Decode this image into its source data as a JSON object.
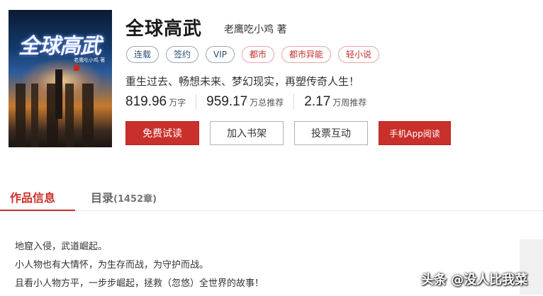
{
  "cover": {
    "title": "全球高武",
    "author": "老鹰吃小鸡 著"
  },
  "book": {
    "title": "全球高武",
    "author_line": "老鹰吃小鸡 著",
    "tags": [
      {
        "label": "连载",
        "style": "blue"
      },
      {
        "label": "签约",
        "style": "blue"
      },
      {
        "label": "VIP",
        "style": "blue"
      },
      {
        "label": "都市",
        "style": "red"
      },
      {
        "label": "都市异能",
        "style": "red"
      },
      {
        "label": "轻小说",
        "style": "red"
      }
    ],
    "intro": "重生过去、畅想未来、梦幻现实，再塑传奇人生！",
    "stats": [
      {
        "num": "819.96",
        "unit": "万字"
      },
      {
        "num": "959.17",
        "unit": "万总推荐"
      },
      {
        "num": "2.17",
        "unit": "万周推荐"
      }
    ]
  },
  "buttons": {
    "free_read": "免费试读",
    "add_shelf": "加入书架",
    "vote": "投票互动",
    "app_read": "手机App阅读"
  },
  "tabs": {
    "info": "作品信息",
    "catalog": "目录",
    "catalog_count": "(1452章)"
  },
  "description": [
    "地窟入侵，武道崛起。",
    "小人物也有大情怀，为生存而战，为守护而战。",
    "且看小人物方平，一步步崛起，拯救（忽悠）全世界的故事！"
  ],
  "watermark": "头条 @没人比我菜",
  "colors": {
    "accent": "#c9302b",
    "tag_blue": "#2d4f73",
    "tag_red": "#c4302b"
  }
}
